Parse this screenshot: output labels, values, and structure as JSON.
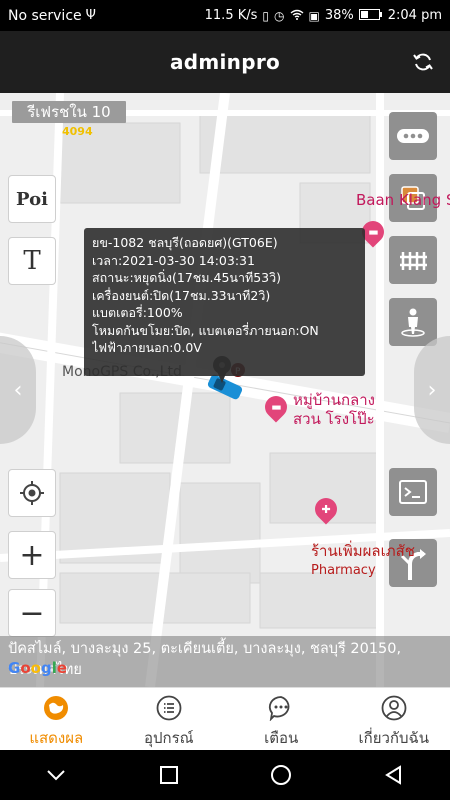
{
  "status_bar": {
    "carrier": "No service",
    "network_speed": "11.5 K/s",
    "battery": "38%",
    "time": "2:04 pm"
  },
  "header": {
    "title": "adminpro"
  },
  "map": {
    "refresh_label": "รีเฟรชใน 10",
    "refresh_count": "4094",
    "poi_label": "Poi",
    "text_tool_label": "T",
    "zoom_in_label": "+",
    "zoom_out_label": "−",
    "arrow_left": "‹",
    "arrow_right": "›",
    "places": {
      "company": "MonoGPS Co.,Ltd",
      "baan": "Baan Klang S",
      "village_line1": "หมู่บ้านกลาง",
      "village_line2": "สวน โรงโป๊ะ",
      "pharmacy_th": "ร้านเพิ่มผลเภสัช",
      "pharmacy_en": "Pharmacy"
    },
    "google_logo": "Google",
    "address": "ปัคสไมล์, บางละมุง 25, ตะเคียนเตี้ย, บางละมุง, ชลบุรี 20150, ประเทศไทย"
  },
  "vehicle_info": {
    "plate": "ยข-1082 ชลบุรี(ถอดยศ)(GT06E)",
    "time": "เวลา:2021-03-30 14:03:31",
    "status": "สถานะ:หยุดนิ่ง(17ชม.45นาที53วิ)",
    "engine": "เครื่องยนต์:ปิด(17ชม.33นาที2วิ)",
    "battery": "แบตเตอรี่:100%",
    "theft_mode": "โหมดกันขโมย:ปิด, แบตเตอรี่ภายนอก:ON",
    "external_power": "ไฟฟ้าภายนอก:0.0V"
  },
  "bottom_nav": {
    "items": [
      {
        "label": "แสดงผล",
        "active": true
      },
      {
        "label": "อุปกรณ์",
        "active": false
      },
      {
        "label": "เตือน",
        "active": false
      },
      {
        "label": "เกี่ยวกับฉัน",
        "active": false
      }
    ]
  },
  "colors": {
    "accent": "#f08c00",
    "header_bg": "#1f1f1f",
    "poi_pink": "#c2185b"
  }
}
